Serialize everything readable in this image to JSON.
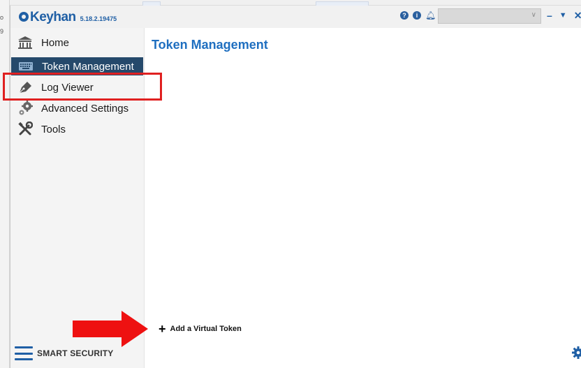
{
  "background": {
    "left_fragments": [
      "o",
      "9"
    ]
  },
  "app": {
    "name": "Keyhan",
    "version": "5.18.2.19475"
  },
  "titlebar": {
    "icons": [
      "help-icon",
      "info-icon",
      "bell-icon"
    ],
    "profile_select_value": "",
    "window_controls": [
      "minimize",
      "dropdown",
      "close"
    ]
  },
  "sidebar": {
    "items": [
      {
        "label": "Home",
        "icon": "bank-icon"
      },
      {
        "label": "Token Management",
        "icon": "keyboard-icon",
        "active": true
      },
      {
        "label": "Log Viewer",
        "icon": "pen-icon"
      },
      {
        "label": "Advanced Settings",
        "icon": "gears-icon"
      },
      {
        "label": "Tools",
        "icon": "tools-icon"
      }
    ],
    "footer_label": "SMART SECURITY"
  },
  "main": {
    "title": "Token Management",
    "add_token_label": "Add a Virtual Token"
  },
  "colors": {
    "brand": "#1f5fa5",
    "active_bg": "#25496b",
    "title": "#1f6fc0",
    "annotation": "#e02020"
  }
}
